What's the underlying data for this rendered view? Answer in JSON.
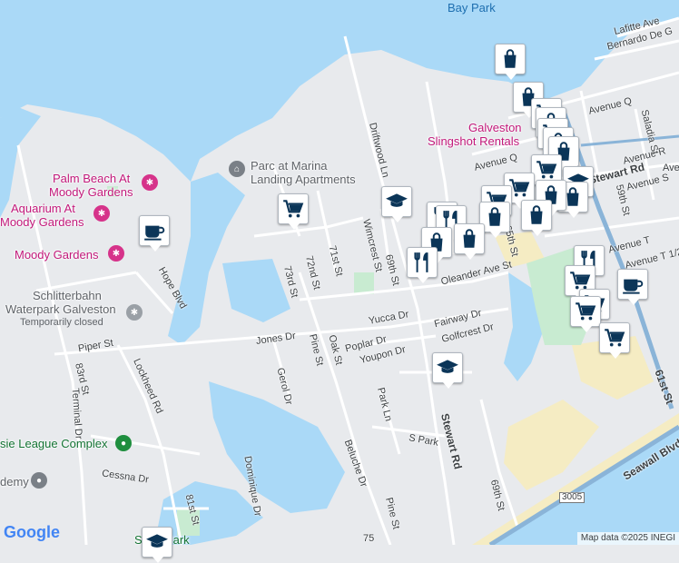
{
  "colors": {
    "water": "#aad9f7",
    "land": "#e8eaed",
    "park": "#c8ebd1",
    "beach": "#f5ecc3",
    "highway": "#8ab4d8",
    "pin_icon": "#0b3558"
  },
  "labels": {
    "bay_park": "Bay Park",
    "palm_beach": "Palm Beach At",
    "palm_beach_2": "Moody Gardens",
    "aquarium": "Aquarium At",
    "aquarium_2": "Moody Gardens",
    "moody_gardens": "Moody Gardens",
    "schlitterbahn": "Schlitterbahn",
    "schlitterbahn_2": "Waterpark Galveston",
    "temporarily_closed": "Temporarily closed",
    "parc_marina": "Parc at Marina",
    "parc_marina_2": "Landing Apartments",
    "slingshot": "Galveston",
    "slingshot_2": "Slingshot Rentals",
    "league_complex": "sie League Complex",
    "academy": "demy",
    "school_park": "Sc  er Park"
  },
  "streets": {
    "lafitte": "Lafitte Ave",
    "bernardo": "Bernardo De G",
    "avenue_q": "Avenue Q",
    "avenue_q2": "Avenue Q",
    "avenue_r": "Avenue R",
    "avenue_s": "Avenue S",
    "avenue_t": "Avenue T",
    "avenue_t_half": "Avenue T 1/2",
    "ave_edge": "Ave",
    "saladia": "Saladia St",
    "st_59": "59th St",
    "stewart_rd_top": "Stewart Rd",
    "stewart_rd": "Stewart Rd",
    "st_61": "61st St",
    "seawall": "Seawall Blvd",
    "driftwood": "Driftwood Ln",
    "wimcrest": "Wimcrest St",
    "st_69": "69th St",
    "st_65": "65th St",
    "oleander": "Oleander Ave St",
    "st_71": "71st St",
    "st_72": "72nd St",
    "st_73": "73rd St",
    "yucca": "Yucca Dr",
    "fairway": "Fairway Dr",
    "golfcrest": "Golfcrest Dr",
    "poplar": "Poplar Dr",
    "oak": "Oak St",
    "youpon": "Youpon Dr",
    "jones": "Jones Dr",
    "pine": "Pine St",
    "pine2": "Pine St",
    "gerol": "Gerol Dr",
    "park_ln": "Park Ln",
    "s_park": "S Park",
    "beluche": "Beluche Dr",
    "st_69b": "69th St",
    "hope": "Hope Blvd",
    "piper": "Piper St",
    "st_83": "83rd St",
    "terminal": "Terminal Dr",
    "lockheed": "Lockheed Rd",
    "cessna": "Cessna Dr",
    "dominique": "Dominique Dr",
    "st_81": "81st St",
    "st_75": "75",
    "route_3005": "3005"
  },
  "markers": [
    {
      "icon": "shopping-bag",
      "name": "shopping-bag-marker-1"
    },
    {
      "icon": "shopping-bag",
      "name": "shopping-bag-marker-2"
    },
    {
      "icon": "shopping-cart",
      "name": "shopping-cart-marker-1"
    },
    {
      "icon": "school",
      "name": "school-marker-1"
    },
    {
      "icon": "coffee",
      "name": "coffee-marker-1"
    },
    {
      "icon": "restaurant",
      "name": "restaurant-marker-1"
    },
    {
      "icon": "school",
      "name": "school-marker-2"
    },
    {
      "icon": "school",
      "name": "school-marker-3"
    },
    {
      "icon": "coffee",
      "name": "coffee-marker-2"
    },
    {
      "icon": "shopping-cart",
      "name": "shopping-cart-marker-2"
    }
  ],
  "footer": {
    "logo": "Google",
    "attribution": "Map data ©2025 INEGI"
  }
}
